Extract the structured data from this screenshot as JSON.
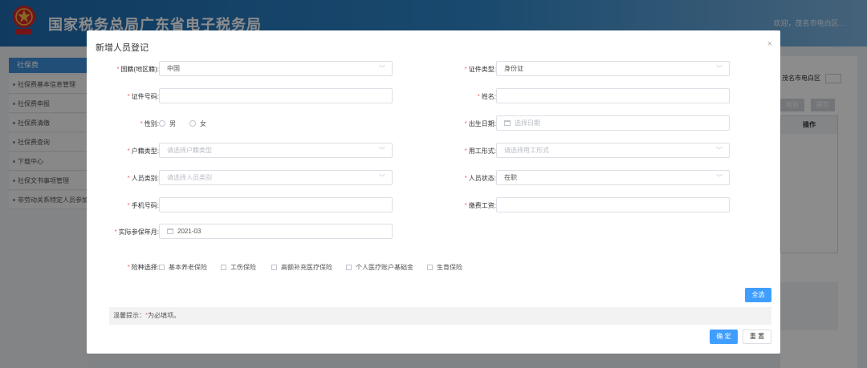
{
  "header": {
    "title": "国家税务总局广东省电子税务局",
    "welcome": "欢迎，茂名市电白区..."
  },
  "sidebar": {
    "title": "社保费",
    "items": [
      "社保费基本信息管理",
      "社保费申报",
      "社保费清缴",
      "社保费查询",
      "下载中心",
      "社保文书事项管理",
      "非劳动关系特定人员参加"
    ]
  },
  "background": {
    "area": "茂名市电白区",
    "btn_verify": "校验",
    "btn_submit": "提交",
    "table_header": "操作"
  },
  "dialog": {
    "title": "新增人员登记",
    "close": "×",
    "fields": {
      "nationality": {
        "label": "国籍(地区籍):",
        "value": "中国"
      },
      "id_type": {
        "label": "证件类型:",
        "value": "身份证"
      },
      "id_number": {
        "label": "证件号码:",
        "value": ""
      },
      "name": {
        "label": "姓名:",
        "value": ""
      },
      "gender": {
        "label": "性别:",
        "options": [
          "男",
          "女"
        ]
      },
      "birth_date": {
        "label": "出生日期:",
        "placeholder": "选择日期"
      },
      "household_type": {
        "label": "户籍类型:",
        "placeholder": "请选择户籍类型"
      },
      "employment_form": {
        "label": "用工形式:",
        "placeholder": "请选择用工形式"
      },
      "person_category": {
        "label": "人员类别:",
        "placeholder": "请选择人员类别"
      },
      "person_status": {
        "label": "人员状态:",
        "value": "在职"
      },
      "phone": {
        "label": "手机号码:",
        "value": ""
      },
      "wage": {
        "label": "缴费工资:",
        "value": ""
      },
      "actual_month": {
        "label": "实际参保年月:",
        "value": "2021-03"
      },
      "insurance": {
        "label": "险种选择:",
        "options": [
          "基本养老保险",
          "工伤保险",
          "高额补充医疗保险",
          "个人医疗账户基础金",
          "生育保险"
        ]
      }
    },
    "select_all": "全选",
    "tip_prefix": "温馨提示：",
    "tip_star": "*",
    "tip_suffix": "为必填项。",
    "confirm": "确 定",
    "reset": "重 置"
  }
}
